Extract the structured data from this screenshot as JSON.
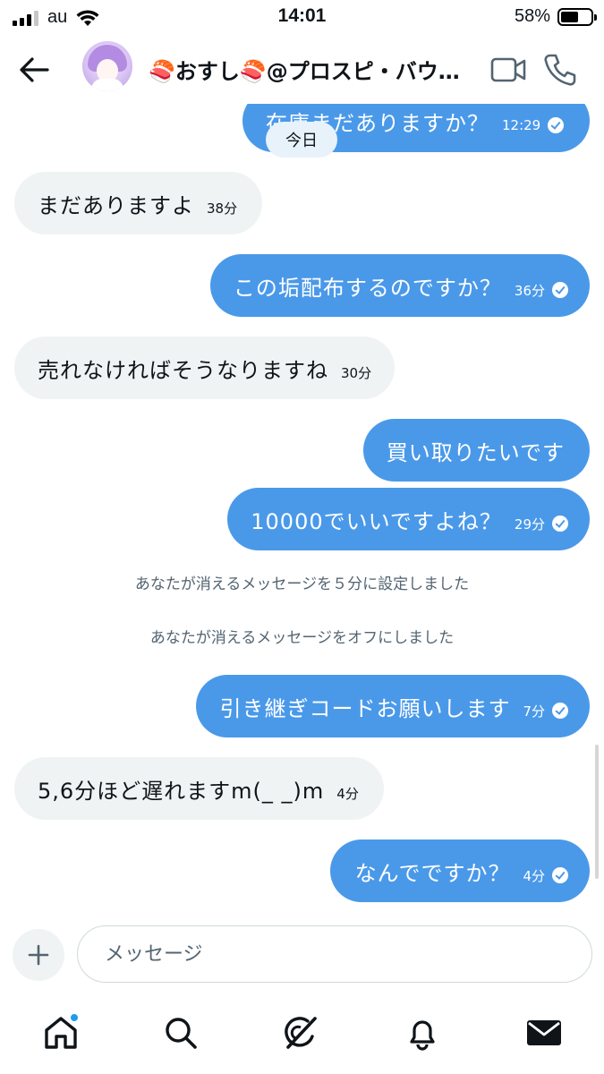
{
  "status_bar": {
    "carrier": "au",
    "time": "14:01",
    "battery": "58%",
    "battery_level": 0.58
  },
  "header": {
    "contact_name": "🍣おすし🍣@プロスピ・バウ…",
    "avatar": "user-avatar",
    "icons": [
      "back-arrow-icon",
      "video-call-icon",
      "phone-call-icon"
    ]
  },
  "chat": {
    "date_chip": "今日",
    "messages": [
      {
        "dir": "out",
        "text": "在庫まだありますか？",
        "time": "12:29",
        "read": true
      },
      {
        "dir": "in",
        "text": "まだありますよ",
        "time": "38分"
      },
      {
        "dir": "out",
        "text": "この垢配布するのですか？",
        "time": "36分",
        "read": true
      },
      {
        "dir": "in",
        "text": "売れなければそうなりますね",
        "time": "30分"
      },
      {
        "dir": "out",
        "text": "買い取りたいです",
        "time": ""
      },
      {
        "dir": "out",
        "text": "10000でいいですよね？",
        "time": "29分",
        "read": true
      },
      {
        "dir": "out",
        "text": "引き継ぎコードお願いします",
        "time": "7分",
        "read": true
      },
      {
        "dir": "in",
        "text": "5,6分ほど遅れますm(_ _)m",
        "time": "4分"
      },
      {
        "dir": "out",
        "text": "なんでですか？",
        "time": "4分",
        "read": true
      }
    ],
    "system_messages": [
      "あなたが消えるメッセージを５分に設定しました",
      "あなたが消えるメッセージをオフにしました"
    ]
  },
  "composer": {
    "placeholder": "メッセージ",
    "add_icon": "plus-icon"
  },
  "tabbar": {
    "items": [
      "home-icon",
      "search-icon",
      "grok-icon",
      "notifications-icon",
      "messages-icon"
    ],
    "colors": {
      "accent": "#1d9bf0",
      "outgoing_bubble": "#4a99e9",
      "incoming_bubble": "#eff3f4"
    }
  }
}
